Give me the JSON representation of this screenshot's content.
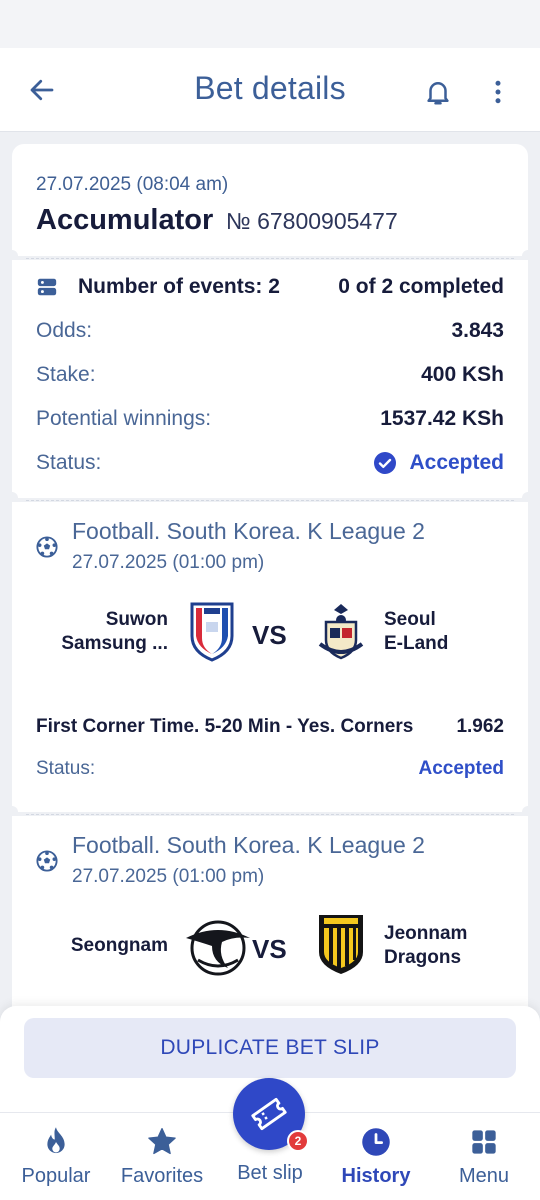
{
  "header": {
    "title": "Bet details"
  },
  "bet": {
    "date": "27.07.2025 (08:04 am)",
    "type": "Accumulator",
    "number": "№ 67800905477"
  },
  "summary": {
    "events_label": "Number of events: 2",
    "completed": "0 of 2 completed",
    "odds_label": "Odds:",
    "odds_value": "3.843",
    "stake_label": "Stake:",
    "stake_value": "400 KSh",
    "winnings_label": "Potential winnings:",
    "winnings_value": "1537.42 KSh",
    "status_label": "Status:",
    "status_value": "Accepted"
  },
  "events": [
    {
      "league": "Football. South Korea. K League 2",
      "date": "27.07.2025 (01:00 pm)",
      "home_line1": "Suwon",
      "home_line2": "Samsung ...",
      "vs": "VS",
      "away_line1": "Seoul",
      "away_line2": "E-Land",
      "market": "First Corner Time. 5-20 Min - Yes. Corners",
      "odd": "1.962",
      "status_label": "Status:",
      "status_value": "Accepted"
    },
    {
      "league": "Football. South Korea. K League 2",
      "date": "27.07.2025 (01:00 pm)",
      "home_line1": "Seongnam",
      "vs": "VS",
      "away_line1": "Jeonnam",
      "away_line2": "Dragons"
    }
  ],
  "actions": {
    "duplicate": "DUPLICATE BET SLIP"
  },
  "nav": {
    "popular": "Popular",
    "favorites": "Favorites",
    "betslip": "Bet slip",
    "betslip_count": "2",
    "history": "History",
    "menu": "Menu"
  },
  "colors": {
    "accent": "#2f48c8",
    "text_dark": "#171c3b",
    "text_muted": "#4a6796",
    "badge": "#e23b3b"
  }
}
